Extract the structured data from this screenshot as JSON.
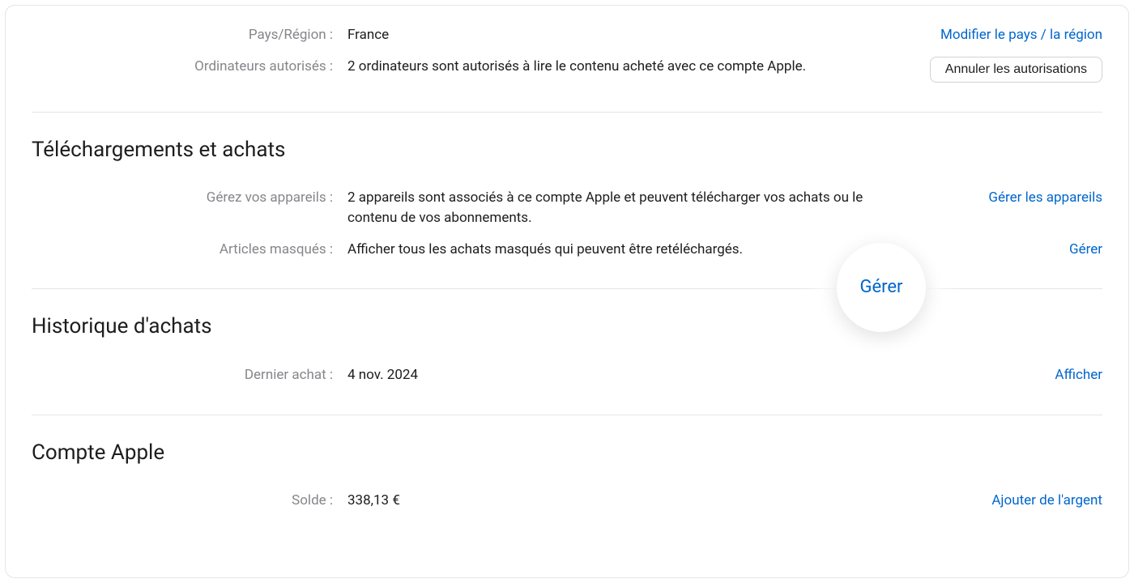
{
  "country": {
    "label": "Pays/Région :",
    "value": "France",
    "action": "Modifier le pays / la région"
  },
  "computers": {
    "label": "Ordinateurs autorisés :",
    "value": "2 ordinateurs sont autorisés à lire le contenu acheté avec ce compte Apple.",
    "action": "Annuler les autorisations"
  },
  "downloads": {
    "title": "Téléchargements et achats",
    "devices": {
      "label": "Gérez vos appareils :",
      "value": "2 appareils sont associés à ce compte Apple et peuvent télécharger vos achats ou le contenu de vos abonnements.",
      "action": "Gérer les appareils"
    },
    "hidden": {
      "label": "Articles masqués :",
      "value": "Afficher tous les achats masqués qui peuvent être retéléchargés.",
      "action": "Gérer"
    }
  },
  "history": {
    "title": "Historique d'achats",
    "last": {
      "label": "Dernier achat :",
      "value": "4 nov. 2024",
      "action": "Afficher"
    }
  },
  "account": {
    "title": "Compte Apple",
    "balance": {
      "label": "Solde :",
      "value": "338,13 €",
      "action": "Ajouter de l'argent"
    }
  },
  "callout": "Gérer"
}
